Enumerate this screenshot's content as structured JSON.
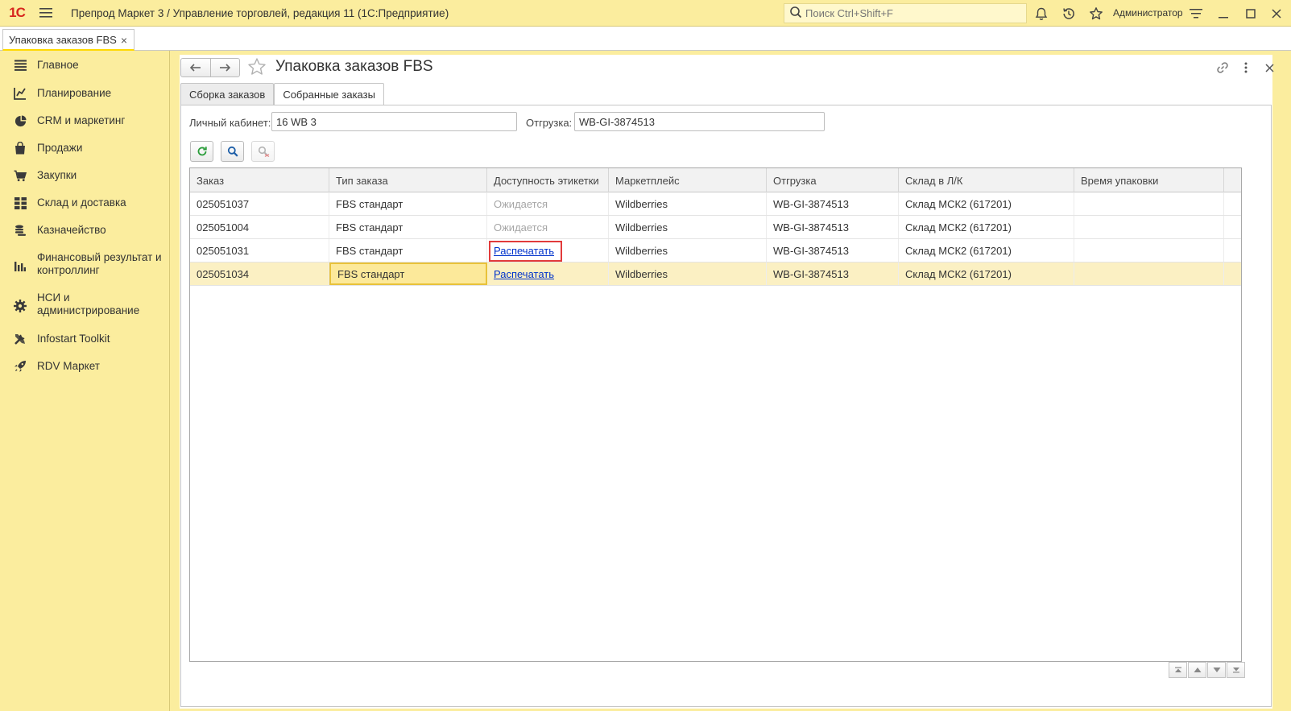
{
  "app": {
    "title": "Препрод Маркет 3 / Управление торговлей, редакция 11  (1С:Предприятие)",
    "logo_text": "1С",
    "search_placeholder": "Поиск Ctrl+Shift+F",
    "user": "Администратор"
  },
  "open_tab": {
    "label": "Упаковка заказов FBS",
    "close": "×"
  },
  "sidebar": {
    "items": [
      {
        "label": "Главное",
        "icon": "list-icon"
      },
      {
        "label": "Планирование",
        "icon": "planning-icon"
      },
      {
        "label": "CRM и маркетинг",
        "icon": "pie-chart-icon"
      },
      {
        "label": "Продажи",
        "icon": "shopping-bag-icon"
      },
      {
        "label": "Закупки",
        "icon": "cart-icon"
      },
      {
        "label": "Склад и доставка",
        "icon": "warehouse-grid-icon"
      },
      {
        "label": "Казначейство",
        "icon": "coins-icon"
      },
      {
        "label": "Финансовый результат и контроллинг",
        "icon": "bar-chart-icon"
      },
      {
        "label": "НСИ и администрирование",
        "icon": "gear-icon"
      },
      {
        "label": "Infostart Toolkit",
        "icon": "tools-icon"
      },
      {
        "label": "RDV Маркет",
        "icon": "rocket-icon"
      }
    ]
  },
  "form": {
    "title": "Упаковка заказов FBS",
    "tabs": [
      {
        "label": "Сборка заказов",
        "active": false
      },
      {
        "label": "Собранные заказы",
        "active": true
      }
    ],
    "fields": {
      "cabinet_label": "Личный кабинет:",
      "cabinet_value": "16 WB 3",
      "shipment_label": "Отгрузка:",
      "shipment_value": "WB-GI-3874513"
    },
    "table": {
      "columns": [
        "Заказ",
        "Тип заказа",
        "Доступность этикетки",
        "Маркетплейс",
        "Отгрузка",
        "Склад в Л/К",
        "Время упаковки"
      ],
      "rows": [
        {
          "order": "025051037",
          "type": "FBS стандарт",
          "label": "Ожидается",
          "label_is_link": false,
          "marketplace": "Wildberries",
          "shipment": "WB-GI-3874513",
          "warehouse": "Склад МСК2 (617201)",
          "time": ""
        },
        {
          "order": "025051004",
          "type": "FBS стандарт",
          "label": "Ожидается",
          "label_is_link": false,
          "marketplace": "Wildberries",
          "shipment": "WB-GI-3874513",
          "warehouse": "Склад МСК2 (617201)",
          "time": ""
        },
        {
          "order": "025051031",
          "type": "FBS стандарт",
          "label": "Распечатать",
          "label_is_link": true,
          "marketplace": "Wildberries",
          "shipment": "WB-GI-3874513",
          "warehouse": "Склад МСК2 (617201)",
          "time": ""
        },
        {
          "order": "025051034",
          "type": "FBS стандарт",
          "label": "Распечатать",
          "label_is_link": true,
          "marketplace": "Wildberries",
          "shipment": "WB-GI-3874513",
          "warehouse": "Склад МСК2 (617201)",
          "time": ""
        }
      ]
    }
  },
  "colors": {
    "accent_yellow": "#fbed9e",
    "logo_red": "#d7261e",
    "link_blue": "#0033cc",
    "highlight_red": "#e23b3b",
    "selected_row": "#fbf0c3"
  }
}
